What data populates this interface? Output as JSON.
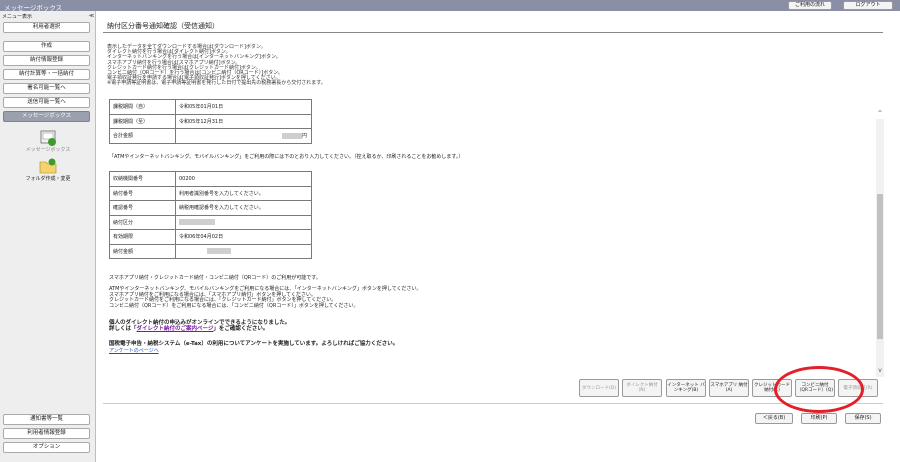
{
  "topbar": {
    "app_title": "メッセージボックス",
    "usage_label": "ご利用の流れ",
    "logout_label": "ログアウト"
  },
  "sidebar": {
    "menu_label": "メニュー表示",
    "pin_label": "≪",
    "items": [
      "利用者選択",
      "作成",
      "納付情報登録",
      "納付計算等・一括納付",
      "署名可能一覧へ",
      "送信可能一覧へ",
      "メッセージボックス"
    ],
    "message_box_icon_label": "メッセージボックス",
    "folder_icon_label": "フォルダ作成・変更",
    "bottom_items": [
      "通知書等一覧",
      "利用者情報登録",
      "オプション"
    ]
  },
  "main": {
    "title": "納付区分番号通知確認（受信通知）",
    "header_lines": [
      "表示したデータを全てダウンロードする場合は[ダウンロード]ボタン。",
      "ダイレクト納付を行う場合は[ダイレクト納付]ボタン。",
      "インターネットバンキングを行う場合は[インターネットバンキング]ボタン。",
      "スマホアプリ納付を行う場合は[スマホアプリ納付]ボタン。",
      "クレジットカード納付を行う場合は[クレジットカード納付]ボタン。",
      "コンビニ納付（QRコード）を行う場合は[コンビニ納付（QRコード）]ボタン。",
      "電子領収証発行を申請する場合は[電子領収証発行]ボタンを押してください。",
      "※電子申請等証明書は、電子申請等証明書を発行した日付で提出先の税務署長から交付されます。"
    ],
    "table1": [
      {
        "label": "課税期間（自）",
        "value": "令和05年01月01日"
      },
      {
        "label": "課税期間（至）",
        "value": "令和05年12月31日"
      },
      {
        "label": "合計金額",
        "value": "円"
      }
    ],
    "note1": "「ATMやインターネットバンキング、モバイルバンキング」をご利用の際には下のとおり入力してください。（控え取るか、印刷されることをお勧めします。）",
    "table2": [
      {
        "label": "収納機関番号",
        "value": "00200"
      },
      {
        "label": "納付番号",
        "value": "利用者識別番号を入力してください。"
      },
      {
        "label": "確認番号",
        "value": "納税用確認番号を入力してください。"
      },
      {
        "label": "納付区分",
        "value": ""
      },
      {
        "label": "有効期限",
        "value": "令和06年04月02日"
      },
      {
        "label": "納付金額",
        "value": ""
      }
    ],
    "note2": "スマホアプリ納付・クレジットカード納付・コンビニ納付（QRコード）のご利用が可能です。",
    "note3": [
      "ATMやインターネットバンキング、モバイルバンキングをご利用になる場合には、「インターネットバンキング」ボタンを押してください。",
      "スマホアプリ納付をご利用になる場合には、「スマホアプリ納付」ボタンを押してください。",
      "クレジットカード納付をご利用になる場合には、「クレジットカード納付」ボタンを押してください。",
      "コンビニ納付（QRコード）をご利用になる場合には、「コンビニ納付（QRコード）」ボタンを押してください。"
    ],
    "bold1_line1": "個人のダイレクト納付の申込みがオンラインでできるようになりました。",
    "bold1_pre": "詳しくは「",
    "bold1_link": "ダイレクト納付のご案内ページ",
    "bold1_post": "」をご確認ください。",
    "bold2": "国税電子申告・納税システム（e-Tax）の利用についてアンケートを実施しています。よろしければご協力ください。",
    "link2": "アンケートのページへ"
  },
  "actions": {
    "download": "ダウンロード(D)",
    "direct": "ダイレクト納付(N)",
    "netbank": "インターネット バンキング(B)",
    "smartphone": "スマホアプリ 納付(A)",
    "credit": "クレジットカード 納付(C)",
    "convenience": "コンビニ納付 （QRコード）(Q)",
    "receipt": "電子領収証(R)",
    "back": "＜戻る(B)",
    "print": "印刷(P)",
    "save": "保存(S)"
  },
  "colors": {
    "topbar": "#8a8fa6",
    "highlight_circle": "#e3202a",
    "link": "#1a4fc9"
  }
}
